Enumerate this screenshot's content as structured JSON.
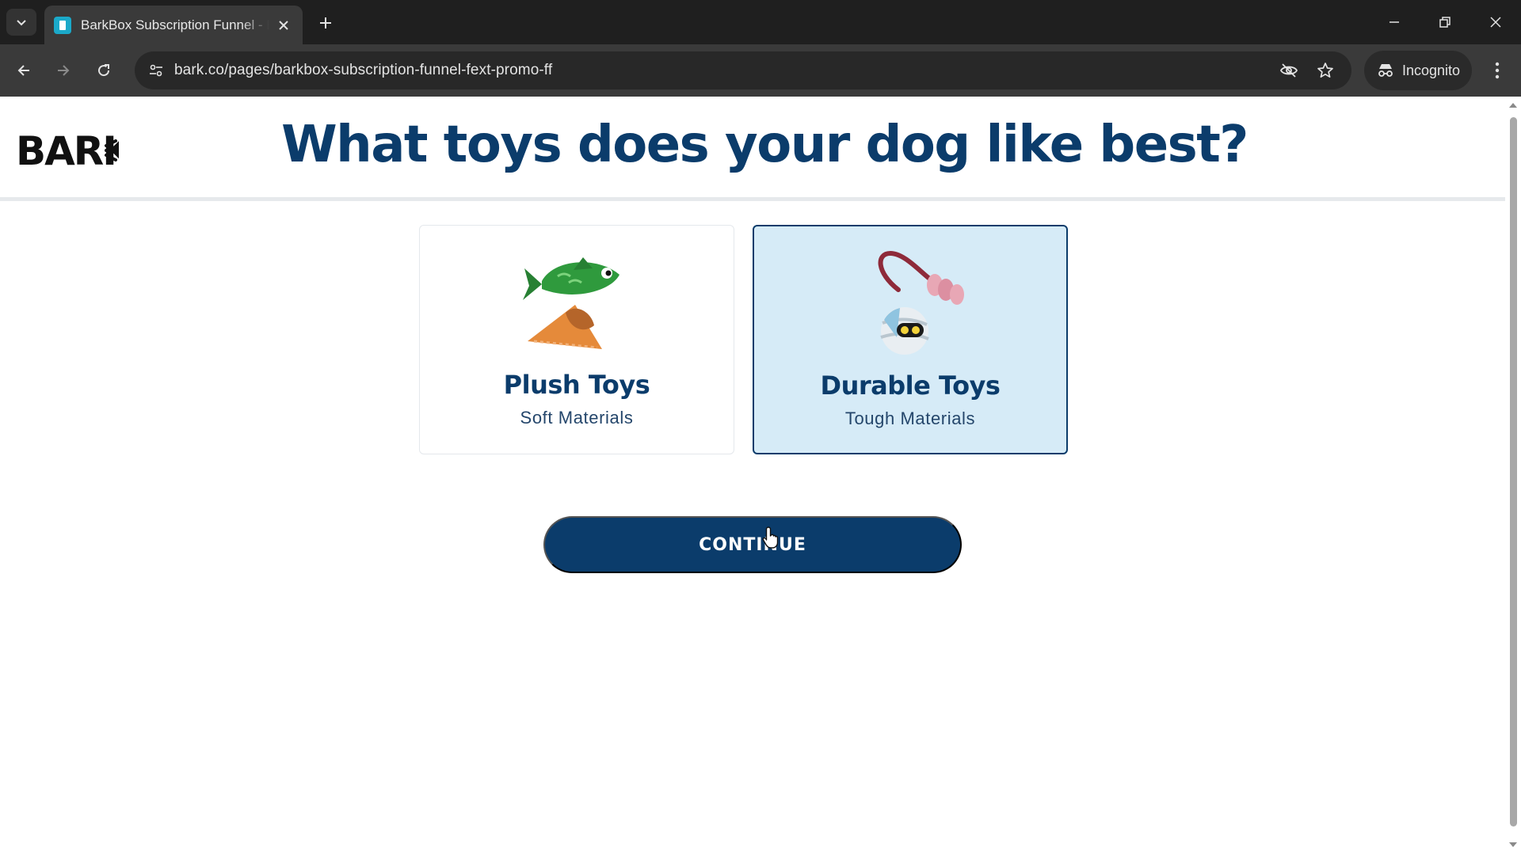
{
  "browser": {
    "tab_title": "BarkBox Subscription Funnel - BarkBox",
    "url": "bark.co/pages/barkbox-subscription-funnel-fext-promo-ff",
    "incognito_label": "Incognito"
  },
  "page": {
    "logo_text": "BARK",
    "question": "What toys does your dog like best?",
    "options": [
      {
        "title": "Plush Toys",
        "subtitle": "Soft Materials",
        "selected": false
      },
      {
        "title": "Durable Toys",
        "subtitle": "Tough Materials",
        "selected": true
      }
    ],
    "continue_label": "CONTINUE"
  },
  "colors": {
    "brand_navy": "#0b3c6b",
    "selected_card_bg": "#d6ebf7",
    "chrome_dark": "#1f1f1f",
    "chrome_toolbar": "#3a3a3a"
  }
}
